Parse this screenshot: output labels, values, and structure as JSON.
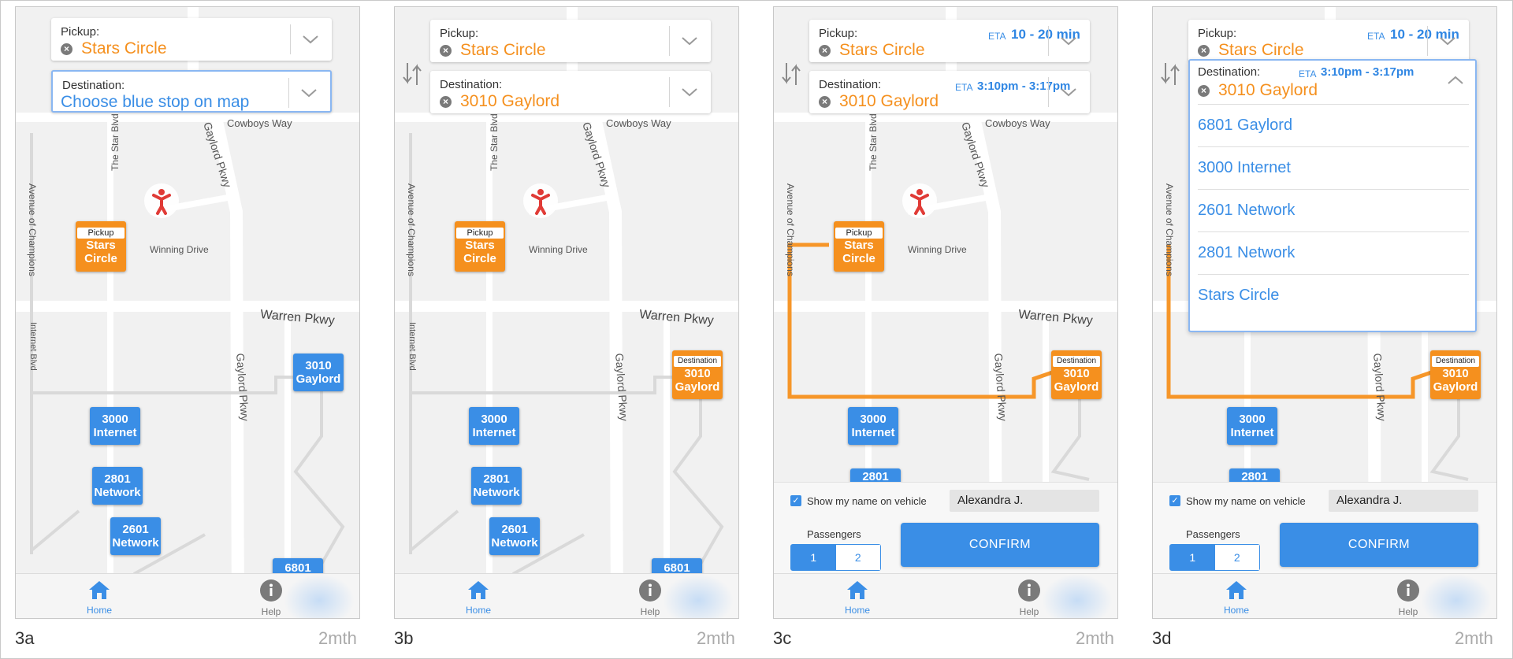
{
  "brand": "2mth",
  "panels": [
    {
      "id": "3a",
      "label": "3a"
    },
    {
      "id": "3b",
      "label": "3b"
    },
    {
      "id": "3c",
      "label": "3c"
    },
    {
      "id": "3d",
      "label": "3d"
    }
  ],
  "fields": {
    "pickup_label": "Pickup:",
    "pickup_value": "Stars Circle",
    "destination_label": "Destination:",
    "destination_placeholder": "Choose blue stop on map",
    "destination_value": "3010 Gaylord",
    "eta_tag": "ETA",
    "pickup_eta": "10 - 20 min",
    "destination_eta": "3:10pm - 3:17pm"
  },
  "map_labels": {
    "cowboys_way": "Cowboys Way",
    "gaylord_pkwy": "Gaylord Pkwy",
    "star_blvd": "The Star Blvd",
    "avenue_champions": "Avenue of Champions",
    "winning_drive": "Winning Drive",
    "warren_pkwy": "Warren Pkwy",
    "internet_blvd": "Internet Blvd"
  },
  "markers": {
    "pickup_tag": "Pickup",
    "destination_tag": "Destination",
    "stars_line1": "Stars",
    "stars_line2": "Circle",
    "g3010_line1": "3010",
    "g3010_line2": "Gaylord",
    "i3000_line1": "3000",
    "i3000_line2": "Internet",
    "n2801_line1": "2801",
    "n2801_line2": "Network",
    "n2601_line1": "2601",
    "n2601_line2": "Network",
    "g6801_line1": "6801"
  },
  "sheet": {
    "show_name_label": "Show my name on vehicle",
    "name_value": "Alexandra J.",
    "passengers_label": "Passengers",
    "pass_1": "1",
    "pass_2": "2",
    "confirm_label": "CONFIRM"
  },
  "dropdown_items": [
    "6801 Gaylord",
    "3000 Internet",
    "2601 Network",
    "2801 Network",
    "Stars Circle"
  ],
  "tabbar": {
    "home": "Home",
    "help": "Help"
  },
  "colors": {
    "accent_blue": "#3a8ee6",
    "route_orange": "#f5901e"
  }
}
